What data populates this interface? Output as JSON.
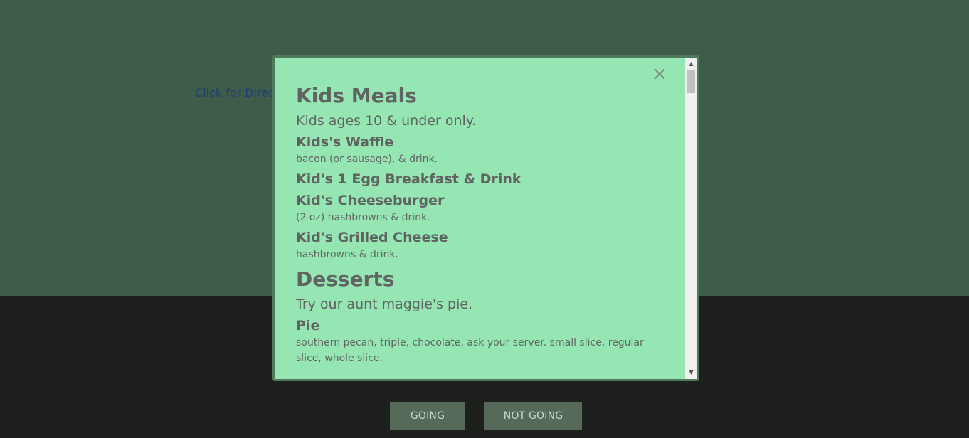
{
  "page": {
    "directions_link": "Click for Direct",
    "going_button": "GOING",
    "not_going_button": "NOT GOING"
  },
  "modal": {
    "sections": [
      {
        "title": "Kids Meals",
        "subtitle": "Kids ages 10 & under only.",
        "items": [
          {
            "name": "Kids's Waffle",
            "desc": "bacon (or sausage), & drink."
          },
          {
            "name": "Kid's 1 Egg Breakfast & Drink",
            "desc": ""
          },
          {
            "name": "Kid's Cheeseburger",
            "desc": "(2 oz) hashbrowns & drink."
          },
          {
            "name": "Kid's Grilled Cheese",
            "desc": "hashbrowns & drink."
          }
        ]
      },
      {
        "title": "Desserts",
        "subtitle": "Try our aunt maggie's pie.",
        "items": [
          {
            "name": "Pie",
            "desc": "southern pecan, triple, chocolate, ask your server. small slice, regular slice, whole slice."
          }
        ]
      }
    ],
    "scroll_up_icon": "▲",
    "scroll_down_icon": "▼"
  },
  "colors": {
    "page_top": "#3f5c4a",
    "page_bottom": "#1e201e",
    "modal_bg": "#96e6b3",
    "modal_border": "#4f7a5b",
    "text": "#5f6463",
    "link": "#1f3d73",
    "button_bg": "#556a59"
  }
}
